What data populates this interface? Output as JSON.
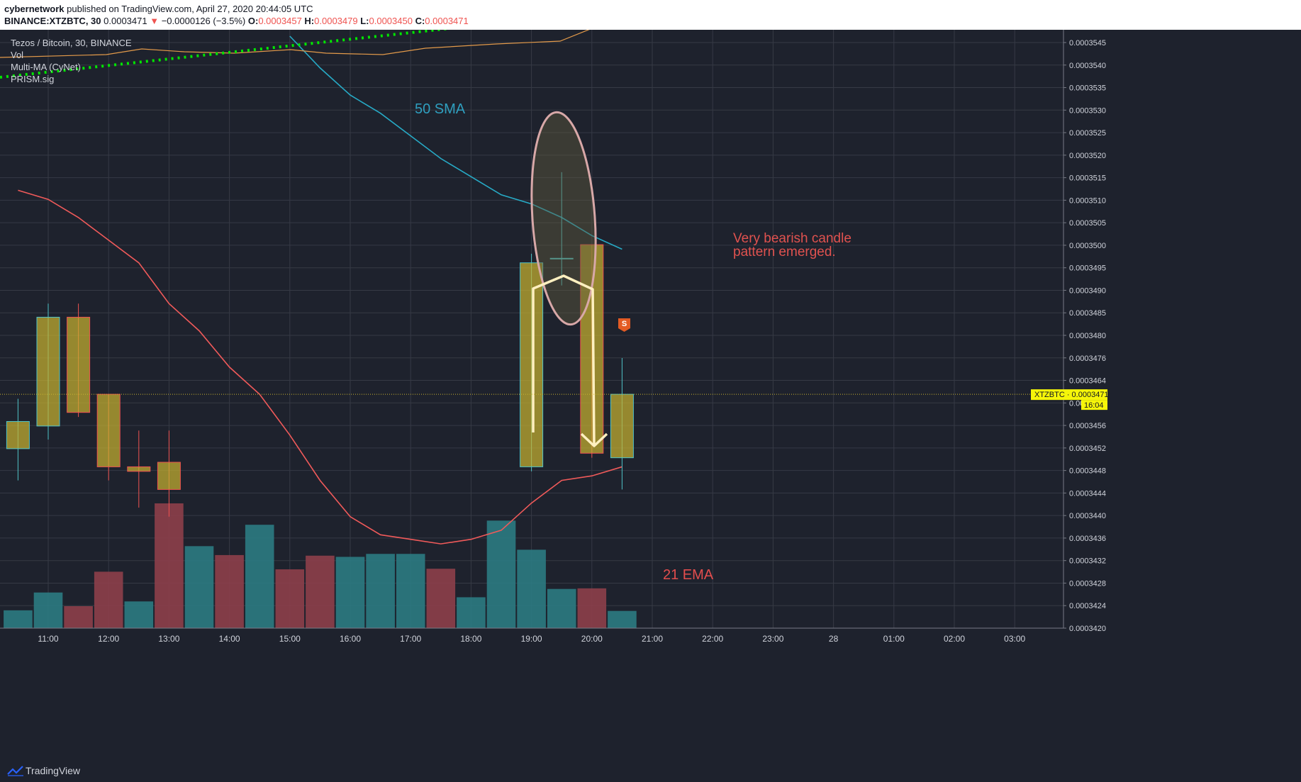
{
  "header": {
    "publisher": "cybernetwork",
    "published_text": " published on TradingView.com, April 27, 2020 20:44:05 UTC",
    "symbol": "BINANCE:XTZBTC, 30",
    "last": "0.0003471",
    "arrow": "▼",
    "change": "−0.0000126 (−3.5%)",
    "o_label": "O:",
    "o": "0.0003457",
    "h_label": "H:",
    "h": "0.0003479",
    "l_label": "L:",
    "l": "0.0003450",
    "c_label": "C:",
    "c": "0.0003471"
  },
  "legend": {
    "title": "Tezos / Bitcoin, 30, BINANCE",
    "items": [
      "Vol",
      "Multi-MA (CyNet)",
      "PRISM.sig"
    ]
  },
  "annotations": {
    "sma_label": "50 SMA",
    "ema_label": "21 EMA",
    "note_line1": "Very bearish candle",
    "note_line2": "pattern emerged.",
    "signal": "S"
  },
  "price_tag": {
    "symbol": "XTZBTC",
    "price": "0.0003471",
    "countdown": "16:04"
  },
  "footer": {
    "brand": "TradingView"
  },
  "colors": {
    "background": "#1e222d",
    "grid": "#363a45",
    "candle_fill": "#c9b430",
    "candle_border_up": "#4fc3c7",
    "candle_border_down": "#ef5350",
    "vol_up": "#2b7b82",
    "vol_down": "#8d3f4a",
    "sma50": "#27aac6",
    "ema21": "#f05a5a",
    "ma_orange": "#e39a4a",
    "prism_dots": "#00e600",
    "ellipse": "#d8a8a8",
    "arrow": "#fff0c0",
    "note_text": "#ef5350"
  },
  "chart_data": {
    "type": "candlestick",
    "x_ticks": [
      "11:00",
      "12:00",
      "13:00",
      "14:00",
      "15:00",
      "16:00",
      "17:00",
      "18:00",
      "19:00",
      "20:00",
      "21:00",
      "22:00",
      "23:00",
      "28",
      "01:00",
      "02:00",
      "03:00"
    ],
    "y_ticks": [
      "0.0003545",
      "0.0003540",
      "0.0003535",
      "0.0003530",
      "0.0003525",
      "0.0003520",
      "0.0003515",
      "0.0003510",
      "0.0003505",
      "0.0003500",
      "0.0003495",
      "0.0003490",
      "0.0003485",
      "0.0003480",
      "0.0003476",
      "0.0003464",
      "0.0003460",
      "0.0003456",
      "0.0003452",
      "0.0003448",
      "0.0003444",
      "0.0003440",
      "0.0003436",
      "0.0003432",
      "0.0003428",
      "0.0003424",
      "0.0003420"
    ],
    "ylim": [
      0.0003418,
      0.000355
    ],
    "candles": [
      {
        "t": "10:30",
        "o": 0.0003459,
        "h": 0.000347,
        "l": 0.0003452,
        "c": 0.0003465
      },
      {
        "t": "11:00",
        "o": 0.0003464,
        "h": 0.0003491,
        "l": 0.0003461,
        "c": 0.0003488
      },
      {
        "t": "11:30",
        "o": 0.0003488,
        "h": 0.0003491,
        "l": 0.0003466,
        "c": 0.0003467
      },
      {
        "t": "12:00",
        "o": 0.0003471,
        "h": 0.0003471,
        "l": 0.0003452,
        "c": 0.0003455
      },
      {
        "t": "12:30",
        "o": 0.0003455,
        "h": 0.0003463,
        "l": 0.0003446,
        "c": 0.0003454
      },
      {
        "t": "13:00",
        "o": 0.0003456,
        "h": 0.0003463,
        "l": 0.0003444,
        "c": 0.000345
      },
      {
        "t": "19:00",
        "o": 0.0003455,
        "h": 0.0003502,
        "l": 0.0003454,
        "c": 0.00035
      },
      {
        "t": "19:30",
        "o": 0.0003501,
        "h": 0.000352,
        "l": 0.0003495,
        "c": 0.0003501
      },
      {
        "t": "20:00",
        "o": 0.0003504,
        "h": 0.0003504,
        "l": 0.0003457,
        "c": 0.0003458
      },
      {
        "t": "20:30",
        "o": 0.0003457,
        "h": 0.0003479,
        "l": 0.000345,
        "c": 0.0003471
      }
    ],
    "volume": [
      {
        "t": "10:30",
        "v": 30,
        "dir": "up"
      },
      {
        "t": "11:00",
        "v": 60,
        "dir": "up"
      },
      {
        "t": "11:30",
        "v": 37,
        "dir": "down"
      },
      {
        "t": "12:00",
        "v": 95,
        "dir": "down"
      },
      {
        "t": "12:30",
        "v": 45,
        "dir": "up"
      },
      {
        "t": "13:00",
        "v": 210,
        "dir": "down"
      },
      {
        "t": "13:30",
        "v": 138,
        "dir": "up"
      },
      {
        "t": "14:00",
        "v": 123,
        "dir": "down"
      },
      {
        "t": "14:30",
        "v": 174,
        "dir": "up"
      },
      {
        "t": "15:00",
        "v": 99,
        "dir": "down"
      },
      {
        "t": "15:30",
        "v": 122,
        "dir": "down"
      },
      {
        "t": "16:00",
        "v": 120,
        "dir": "up"
      },
      {
        "t": "16:30",
        "v": 125,
        "dir": "up"
      },
      {
        "t": "17:00",
        "v": 125,
        "dir": "up"
      },
      {
        "t": "17:30",
        "v": 100,
        "dir": "down"
      },
      {
        "t": "18:00",
        "v": 52,
        "dir": "up"
      },
      {
        "t": "18:30",
        "v": 181,
        "dir": "up"
      },
      {
        "t": "19:00",
        "v": 132,
        "dir": "up"
      },
      {
        "t": "19:30",
        "v": 66,
        "dir": "up"
      },
      {
        "t": "20:00",
        "v": 67,
        "dir": "down"
      },
      {
        "t": "20:30",
        "v": 29,
        "dir": "up"
      }
    ],
    "ema21": [
      {
        "t": "10:30",
        "v": 0.0003516
      },
      {
        "t": "11:00",
        "v": 0.0003514
      },
      {
        "t": "11:30",
        "v": 0.000351
      },
      {
        "t": "12:00",
        "v": 0.0003505
      },
      {
        "t": "12:30",
        "v": 0.00035
      },
      {
        "t": "13:00",
        "v": 0.0003491
      },
      {
        "t": "13:30",
        "v": 0.0003485
      },
      {
        "t": "14:00",
        "v": 0.0003477
      },
      {
        "t": "14:30",
        "v": 0.0003471
      },
      {
        "t": "15:00",
        "v": 0.0003462
      },
      {
        "t": "15:30",
        "v": 0.0003452
      },
      {
        "t": "16:00",
        "v": 0.0003444
      },
      {
        "t": "16:30",
        "v": 0.000344
      },
      {
        "t": "17:00",
        "v": 0.0003439
      },
      {
        "t": "17:30",
        "v": 0.0003438
      },
      {
        "t": "18:00",
        "v": 0.0003439
      },
      {
        "t": "18:30",
        "v": 0.0003441
      },
      {
        "t": "19:00",
        "v": 0.0003447
      },
      {
        "t": "19:30",
        "v": 0.0003452
      },
      {
        "t": "20:00",
        "v": 0.0003453
      },
      {
        "t": "20:30",
        "v": 0.0003455
      }
    ],
    "sma50": [
      {
        "t": "15:00",
        "v": 0.000355
      },
      {
        "t": "15:30",
        "v": 0.0003543
      },
      {
        "t": "16:00",
        "v": 0.0003537
      },
      {
        "t": "16:30",
        "v": 0.0003533
      },
      {
        "t": "17:00",
        "v": 0.0003528
      },
      {
        "t": "17:30",
        "v": 0.0003523
      },
      {
        "t": "18:00",
        "v": 0.0003519
      },
      {
        "t": "18:30",
        "v": 0.0003515
      },
      {
        "t": "19:00",
        "v": 0.0003513
      },
      {
        "t": "19:30",
        "v": 0.000351
      },
      {
        "t": "20:00",
        "v": 0.0003506
      },
      {
        "t": "20:30",
        "v": 0.0003503
      }
    ]
  }
}
